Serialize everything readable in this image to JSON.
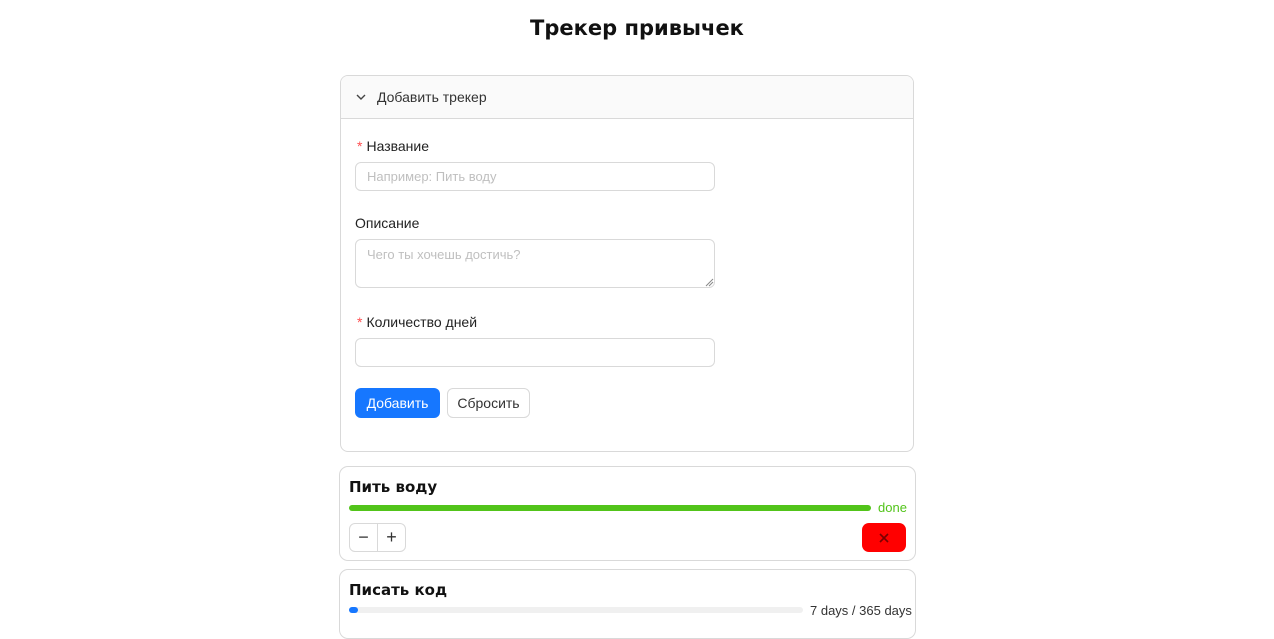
{
  "page": {
    "title": "Трекер привычек"
  },
  "add_panel": {
    "header_label": "Добавить трекер",
    "name_label": "Название",
    "name_placeholder": "Например: Пить воду",
    "name_value": "",
    "description_label": "Описание",
    "description_placeholder": "Чего ты хочешь достичь?",
    "description_value": "",
    "days_label": "Количество дней",
    "days_placeholder": "",
    "days_value": "",
    "submit_label": "Добавить",
    "reset_label": "Сбросить",
    "required_mark": "*"
  },
  "trackers": [
    {
      "title": "Пить воду",
      "progress_fraction": 1.0,
      "status_text": "done",
      "bar_color": "#52c41a",
      "decrement_label": "−",
      "increment_label": "+",
      "delete_icon": "close-icon",
      "delete_color": "#ff0000"
    },
    {
      "title": "Писать код",
      "progress_fraction": 0.0192,
      "status_text": "7 days / 365 days",
      "bar_color": "#1677ff"
    }
  ],
  "colors": {
    "primary": "#1677ff",
    "required": "#ff4d4f",
    "done": "#52c41a",
    "danger": "#ff0000"
  }
}
